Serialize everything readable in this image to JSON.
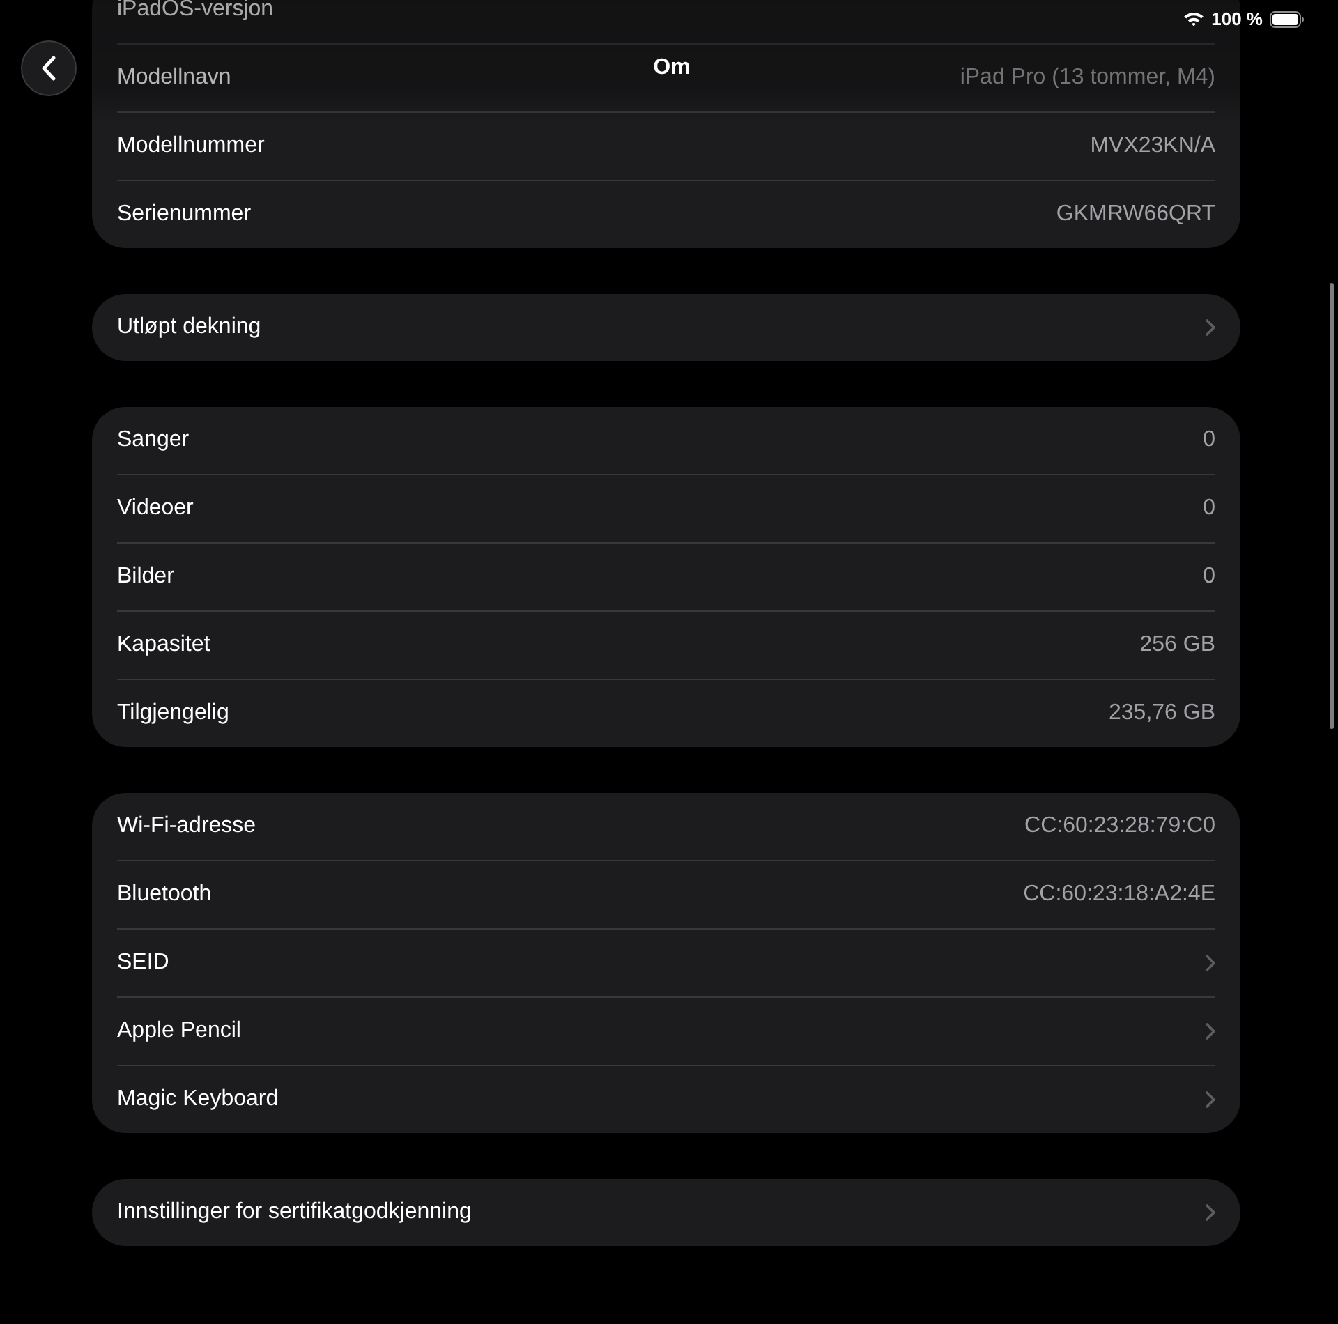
{
  "status_bar": {
    "battery_text": "100 %"
  },
  "nav": {
    "title": "Om"
  },
  "groups": [
    {
      "rows": [
        {
          "kind": "value",
          "label": "iPadOS-versjon"
        },
        {
          "kind": "value",
          "label": "Modellnavn",
          "value": "iPad Pro (13 tommer, M4)"
        },
        {
          "kind": "value",
          "label": "Modellnummer",
          "value": "MVX23KN/A"
        },
        {
          "kind": "value",
          "label": "Serienummer",
          "value": "GKMRW66QRT"
        }
      ]
    },
    {
      "rows": [
        {
          "kind": "link",
          "label": "Utløpt dekning"
        }
      ]
    },
    {
      "rows": [
        {
          "kind": "value",
          "label": "Sanger",
          "value": "0"
        },
        {
          "kind": "value",
          "label": "Videoer",
          "value": "0"
        },
        {
          "kind": "value",
          "label": "Bilder",
          "value": "0"
        },
        {
          "kind": "value",
          "label": "Kapasitet",
          "value": "256 GB"
        },
        {
          "kind": "value",
          "label": "Tilgjengelig",
          "value": "235,76 GB"
        }
      ]
    },
    {
      "rows": [
        {
          "kind": "value",
          "label": "Wi-Fi-adresse",
          "value": "CC:60:23:28:79:C0"
        },
        {
          "kind": "value",
          "label": "Bluetooth",
          "value": "CC:60:23:18:A2:4E"
        },
        {
          "kind": "link",
          "label": "SEID"
        },
        {
          "kind": "link",
          "label": "Apple Pencil"
        },
        {
          "kind": "link",
          "label": "Magic Keyboard"
        }
      ]
    },
    {
      "rows": [
        {
          "kind": "link",
          "label": "Innstillinger for sertifikatgodkjenning"
        }
      ]
    }
  ]
}
